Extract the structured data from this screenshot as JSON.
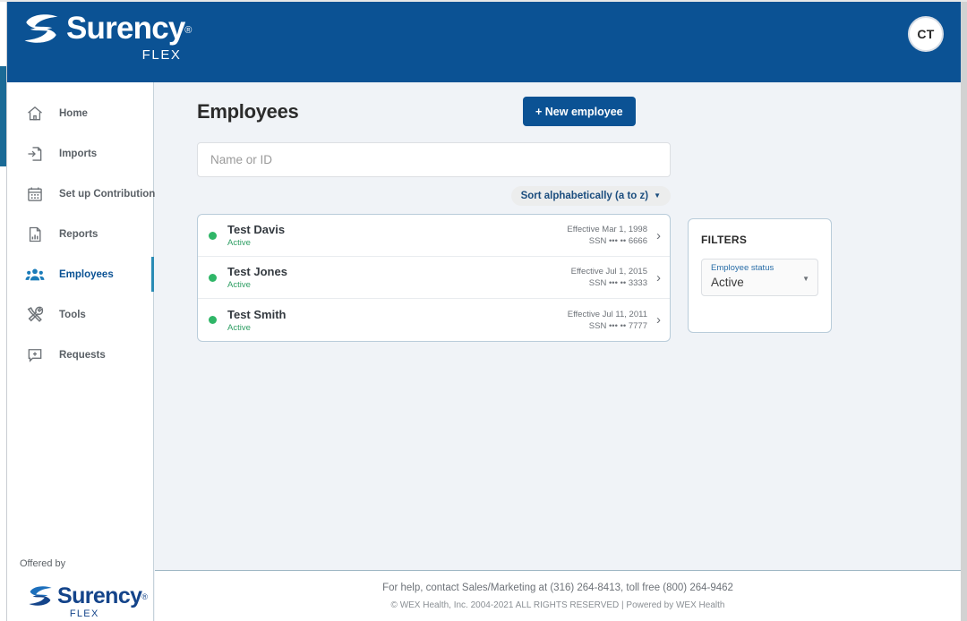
{
  "brand": {
    "name": "Surency",
    "trademark": "®",
    "sub": "FLEX"
  },
  "topbar": {
    "avatar_initials": "CT"
  },
  "sidebar": {
    "items": [
      {
        "label": "Home",
        "icon": "home-icon",
        "active": false
      },
      {
        "label": "Imports",
        "icon": "import-file-icon",
        "active": false
      },
      {
        "label": "Set up Contributions",
        "icon": "calendar-icon",
        "active": false
      },
      {
        "label": "Reports",
        "icon": "report-document-icon",
        "active": false
      },
      {
        "label": "Employees",
        "icon": "people-group-icon",
        "active": true
      },
      {
        "label": "Tools",
        "icon": "tools-icon",
        "active": false
      },
      {
        "label": "Requests",
        "icon": "add-request-icon",
        "active": false
      }
    ],
    "offered_by": "Offered by"
  },
  "main": {
    "page_title": "Employees",
    "new_employee_label": "+ New employee",
    "search": {
      "placeholder": "Name or ID",
      "value": ""
    },
    "sort": {
      "label": "Sort alphabetically (a to z)"
    },
    "employees": [
      {
        "name": "Test Davis",
        "status": "Active",
        "effective": "Effective Mar 1, 1998",
        "ssn": "SSN ••• •• 6666"
      },
      {
        "name": "Test Jones",
        "status": "Active",
        "effective": "Effective Jul 1, 2015",
        "ssn": "SSN ••• •• 3333"
      },
      {
        "name": "Test Smith",
        "status": "Active",
        "effective": "Effective Jul 11, 2011",
        "ssn": "SSN ••• •• 7777"
      }
    ]
  },
  "filters": {
    "title": "FILTERS",
    "employee_status": {
      "label": "Employee status",
      "value": "Active"
    }
  },
  "footer": {
    "help": "For help, contact Sales/Marketing at (316) 264-8413, toll free (800) 264-9462",
    "copyright": "© WEX Health, Inc. 2004-2021 ALL RIGHTS RESERVED | Powered by WEX Health"
  },
  "colors": {
    "brand_blue": "#0b5294",
    "content_bg": "#f0f3f7",
    "active_green": "#2fb667",
    "accent_teal": "#2a8cb5"
  }
}
